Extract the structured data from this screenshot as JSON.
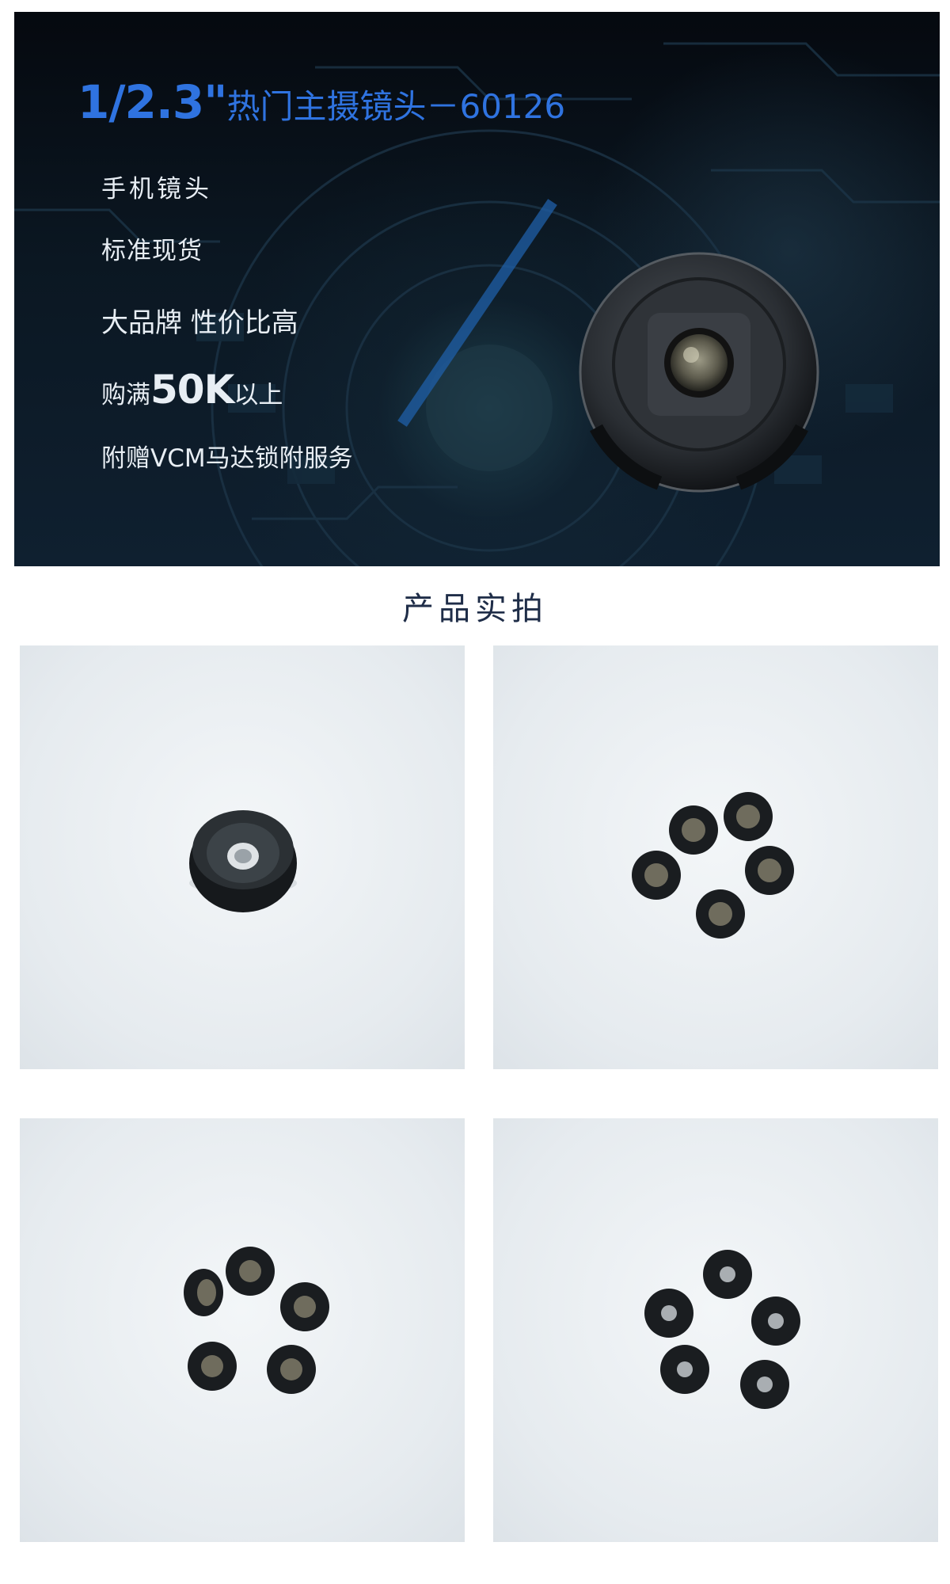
{
  "hero": {
    "title_model": "1/2.3\"",
    "title_name": "热门主摄镜头－60126",
    "features": {
      "f1": "手机镜头",
      "f2": "标准现货",
      "f3": "大品牌 性价比高",
      "f4_prefix": "购满",
      "f4_highlight": "50K",
      "f4_suffix": "以上",
      "f5": "附赠VCM马达锁附服务"
    },
    "accent_color": "#2f73e0"
  },
  "section": {
    "title": "产品实拍"
  },
  "photos": [
    {
      "icon": "single-lens-photo"
    },
    {
      "icon": "five-lens-flower-photo"
    },
    {
      "icon": "five-lens-circle-photo"
    },
    {
      "icon": "five-lens-ring-photo"
    }
  ]
}
